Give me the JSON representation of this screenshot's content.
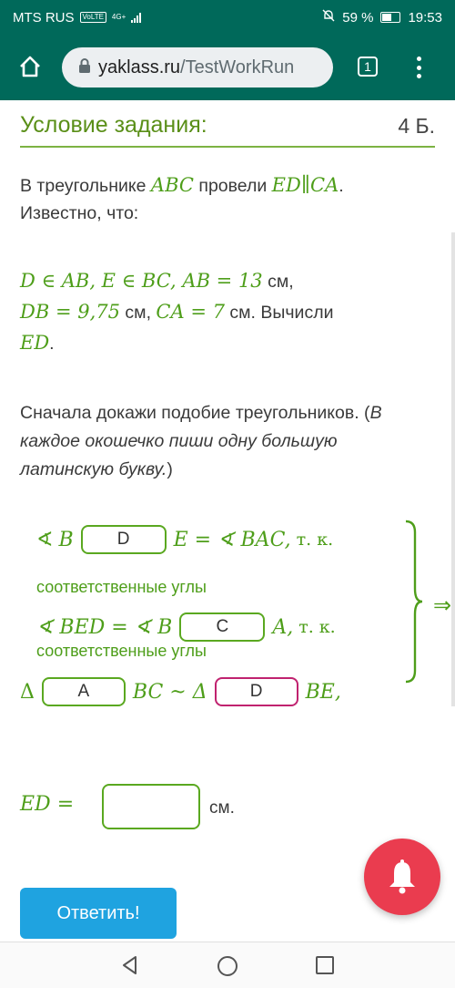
{
  "status": {
    "carrier": "MTS RUS",
    "volte": "VoLTE",
    "net": "4G+",
    "battery": "59 %",
    "time": "19:53"
  },
  "browser": {
    "url_main": "yaklass.ru",
    "url_path": "/TestWorkRun",
    "tab_count": "1"
  },
  "task": {
    "title": "Условие задания:",
    "points": "4 Б.",
    "p1_a": "В треугольнике",
    "p1_abc": "ABC",
    "p1_b": "провели",
    "p1_ed": "ED",
    "p1_par": "∥",
    "p1_ca": "CA",
    "p1_c": ".",
    "p1_line2": "Известно, что:",
    "given": {
      "l1_math": "D ∈ AB, E ∈ BC, AB = 13",
      "l1_unit": "см,",
      "l2_math1": "DB = 9,75",
      "l2_unit1": "см,",
      "l2_math2": "CA = 7",
      "l2_unit2": "см. Вычисли",
      "l3_math": "ED",
      "l3_tail": "."
    },
    "instr_normal": "Сначала докажи подобие треугольников. (",
    "instr_italic1": "В",
    "instr_italic2": "каждое окошечко пиши одну большую",
    "instr_italic3": "латинскую букву.",
    "instr_close": ")"
  },
  "system": {
    "row1": {
      "angle": "∢",
      "pre": "B",
      "box": "D",
      "post": "E = ∢ BAC,",
      "tk": "т. к."
    },
    "row1_caption": "соответственные углы",
    "row2": {
      "pre": "∢ BED = ∢ B",
      "box": "C",
      "post": "A,",
      "tk": "т. к."
    },
    "row2_caption": "соответственные углы",
    "implies": "⇒",
    "similar": {
      "delta1": "Δ",
      "box1": "A",
      "mid": "BC ~ Δ",
      "box2": "D",
      "post": "BE,"
    }
  },
  "answer": {
    "label": "ED =",
    "value": "",
    "unit": "см."
  },
  "submit_label": "Ответить!",
  "colors": {
    "header": "#00695a",
    "green": "#4e9e1a",
    "submit": "#1fa3e0",
    "pink_box": "#c0226f",
    "bell": "#ea3c4f"
  }
}
